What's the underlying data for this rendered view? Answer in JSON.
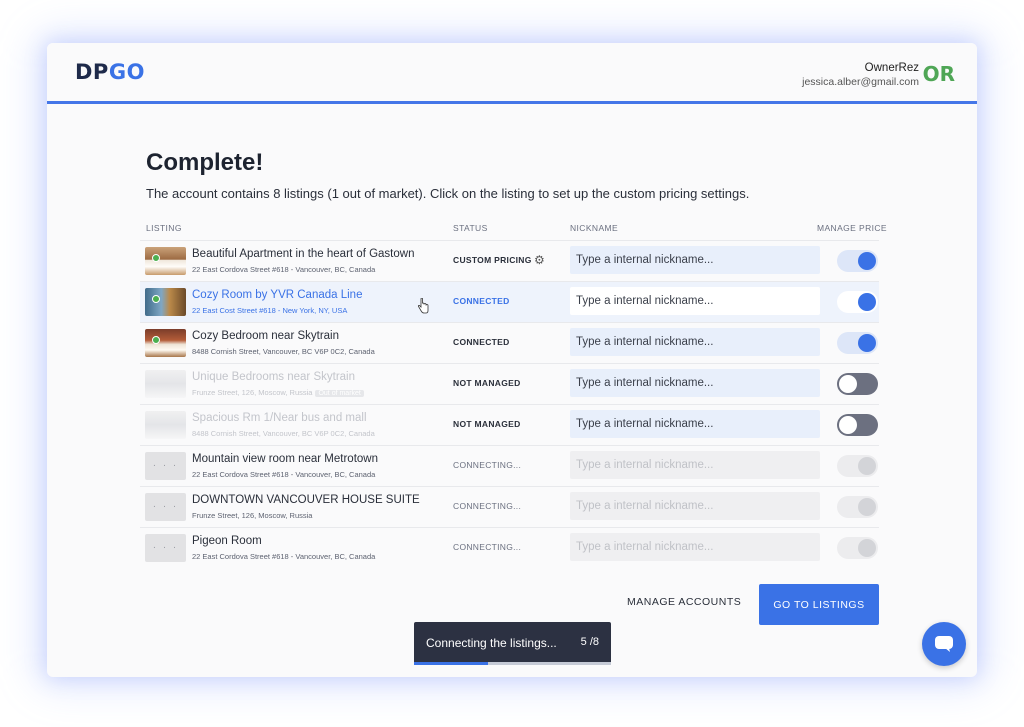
{
  "header": {
    "logo_dp": "DP",
    "logo_go": "GO",
    "account_name": "OwnerRez",
    "account_email": "jessica.alber@gmail.com",
    "account_logo": "OR"
  },
  "main": {
    "title": "Complete!",
    "subtitle": "The account contains 8 listings (1 out of market). Click on the listing to set up the custom pricing settings."
  },
  "columns": {
    "listing": "LISTING",
    "status": "STATUS",
    "nickname": "NICKNAME",
    "manage_price": "MANAGE PRICE"
  },
  "nickname_placeholder": "Type a internal nickname...",
  "listings": [
    {
      "name": "Beautiful Apartment in the heart of Gastown",
      "address": "22 East Cordova Street #618 - Vancouver, BC, Canada",
      "status": "CUSTOM PRICING",
      "thumb_icon": "bedroom-photo",
      "toggle": "on"
    },
    {
      "name": "Cozy Room by YVR Canada Line",
      "address": "22 East Cost Street #618 - New York, NY, USA",
      "status": "CONNECTED",
      "thumb_icon": "room-photo",
      "toggle": "on"
    },
    {
      "name": "Cozy Bedroom near Skytrain",
      "address": "8488 Cornish Street, Vancouver, BC V6P 0C2, Canada",
      "status": "CONNECTED",
      "thumb_icon": "bedroom-photo",
      "toggle": "on"
    },
    {
      "name": "Unique Bedrooms near Skytrain",
      "address": "Frunze Street, 126, Moscow, Russia",
      "badge": "Out of market",
      "status": "NOT MANAGED",
      "thumb_icon": "room-photo",
      "toggle": "off"
    },
    {
      "name": "Spacious Rm 1/Near bus and mall",
      "address": "8488 Cornish Street, Vancouver, BC V6P 0C2, Canada",
      "status": "NOT MANAGED",
      "thumb_icon": "room-photo",
      "toggle": "off"
    },
    {
      "name": "Mountain view room near Metrotown",
      "address": "22 East Cordova Street #618 - Vancouver, BC, Canada",
      "status": "CONNECTING...",
      "thumb_icon": "loading-dots",
      "toggle": "disabled"
    },
    {
      "name": "DOWNTOWN VANCOUVER HOUSE SUITE",
      "address": "Frunze Street, 126, Moscow, Russia",
      "status": "CONNECTING...",
      "thumb_icon": "loading-dots",
      "toggle": "disabled"
    },
    {
      "name": "Pigeon Room",
      "address": "22 East Cordova Street #618 - Vancouver, BC, Canada",
      "status": "CONNECTING...",
      "thumb_icon": "loading-dots",
      "toggle": "disabled"
    }
  ],
  "actions": {
    "manage_accounts": "MANAGE ACCOUNTS",
    "go_to_listings": "GO TO LISTINGS"
  },
  "toast": {
    "text": "Connecting the listings...",
    "count": "5 /8",
    "progress": 0.375
  },
  "colors": {
    "accent": "#3a72e6",
    "live_dot": "#4caf50",
    "brand_logo_or": "#4fa656"
  },
  "icons": {
    "gear": "gear-icon",
    "chat": "chat-bubble-icon",
    "cursor": "hand-pointer-icon",
    "loading": "loading-dots"
  }
}
